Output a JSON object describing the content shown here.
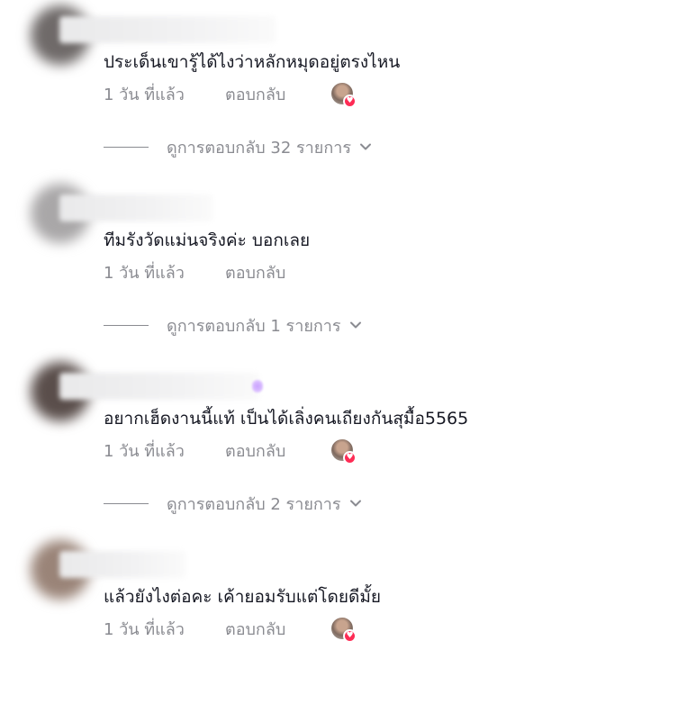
{
  "comments": [
    {
      "text": "ประเด็นเขารู้ได้ไงว่าหลักหมุดอยู่ตรงไหน",
      "time": "1 วัน ที่แล้ว",
      "reply_label": "ตอบกลับ",
      "creator_liked": true,
      "view_replies": "ดูการตอบกลับ 32 รายการ",
      "avatar_color": "#6f6a69"
    },
    {
      "text": "ทีมรังวัดแม่นจริงค่ะ บอกเลย",
      "time": "1 วัน ที่แล้ว",
      "reply_label": "ตอบกลับ",
      "creator_liked": false,
      "view_replies": "ดูการตอบกลับ 1 รายการ",
      "avatar_color": "#a9a7a8"
    },
    {
      "text": "อยากเฮ็ดงานนี้แท้ เป็นได้เลิ่งคนเถียงกันสุมื้อ5565",
      "time": "1 วัน ที่แล้ว",
      "reply_label": "ตอบกลับ",
      "creator_liked": true,
      "view_replies": "ดูการตอบกลับ 2 รายการ",
      "avatar_color": "#5a4e4b"
    },
    {
      "text": "แล้วยังไงต่อคะ เค้ายอมรับแต่โดยดีมั้ย",
      "time": "1 วัน ที่แล้ว",
      "reply_label": "ตอบกลับ",
      "creator_liked": true,
      "view_replies": "",
      "avatar_color": "#9a8478"
    }
  ],
  "colors": {
    "muted_text": "#8a8b91",
    "primary_text": "#161823",
    "like_heart": "#fe2c55"
  },
  "icons": {
    "chevron": "chevron-down-icon",
    "heart": "heart-icon"
  }
}
